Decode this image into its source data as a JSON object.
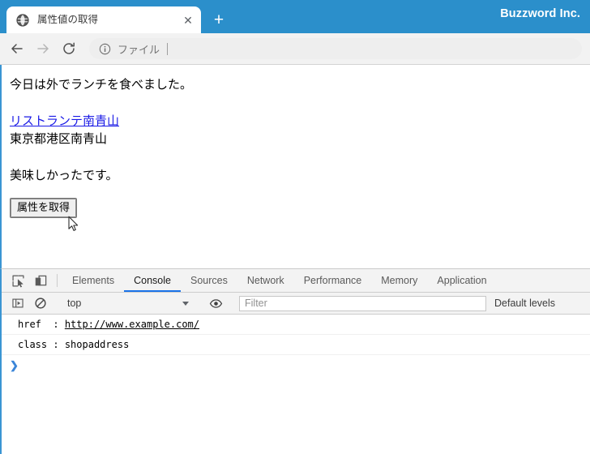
{
  "window": {
    "brand": "Buzzword Inc."
  },
  "tabstrip": {
    "tab_title": "属性値の取得",
    "favicon": "globe-icon",
    "close_label": "✕",
    "newtab_label": "+"
  },
  "toolbar": {
    "back_label": "back-arrow-icon",
    "forward_label": "forward-arrow-icon",
    "reload_label": "reload-icon",
    "omnibox_icon": "info-circle-icon",
    "omnibox_text": "ファイル"
  },
  "page": {
    "line1": "今日は外でランチを食べました。",
    "link_text": "リストランテ南青山",
    "address": "東京都港区南青山",
    "line2": "美味しかったです。",
    "button_label": "属性を取得",
    "link_color": "#1a1ae6"
  },
  "devtools": {
    "inspect_icon": "inspect-element-icon",
    "device_icon": "device-toolbar-icon",
    "tabs": [
      {
        "label": "Elements",
        "active": false
      },
      {
        "label": "Console",
        "active": true
      },
      {
        "label": "Sources",
        "active": false
      },
      {
        "label": "Network",
        "active": false
      },
      {
        "label": "Performance",
        "active": false
      },
      {
        "label": "Memory",
        "active": false
      },
      {
        "label": "Application",
        "active": false
      }
    ],
    "active_tab_color": "#1a73e8",
    "console_toolbar": {
      "sidebar_icon": "console-sidebar-icon",
      "clear_icon": "clear-console-icon",
      "context": "top",
      "eye_icon": "eye-icon",
      "filter_placeholder": "Filter",
      "levels_label": "Default levels"
    },
    "console_rows": [
      {
        "key": "href",
        "sep": ":",
        "value": "http://www.example.com/",
        "is_link": true
      },
      {
        "key": "class",
        "sep": ":",
        "value": "shopaddress",
        "is_link": false
      }
    ],
    "prompt": "❯"
  }
}
